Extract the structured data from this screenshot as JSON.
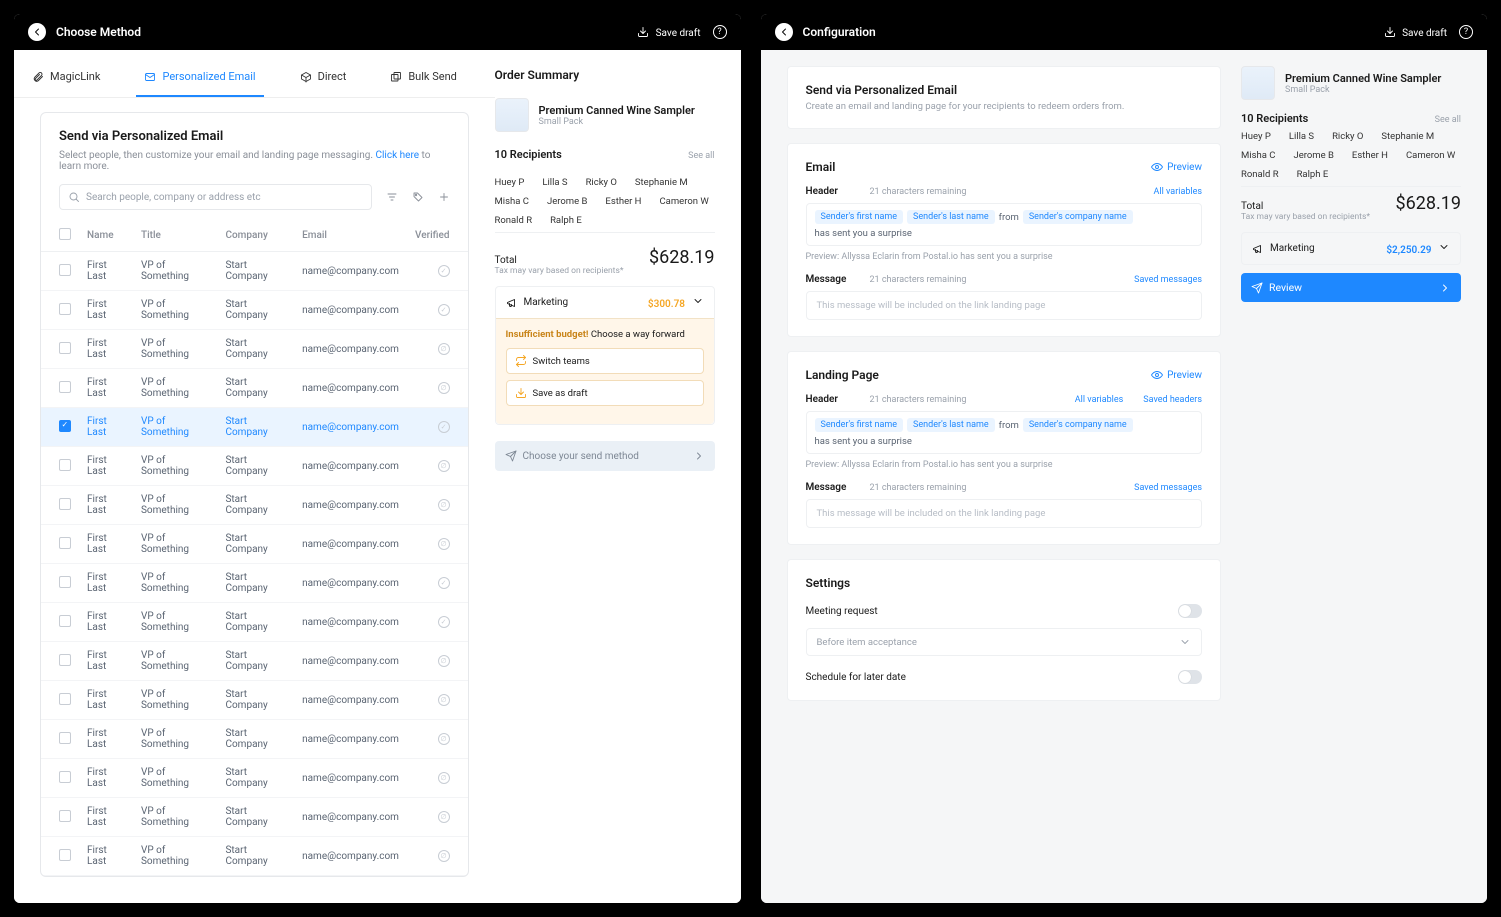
{
  "left": {
    "topbar": {
      "title": "Choose Method",
      "save_draft": "Save draft"
    },
    "tabs": {
      "magiclink": "MagicLink",
      "email": "Personalized Email",
      "direct": "Direct",
      "bulk": "Bulk Send"
    },
    "card": {
      "title": "Send via Personalized Email",
      "subtext_pre": "Select people, then customize your email and landing page messaging. ",
      "subtext_link": "Click here",
      "subtext_post": " to learn more.",
      "search_placeholder": "Search people, company or address etc"
    },
    "table": {
      "headers": {
        "name": "Name",
        "title": "Title",
        "company": "Company",
        "email": "Email",
        "verified": "Verified"
      },
      "selected_index": 4,
      "rows": [
        {
          "name": "First Last",
          "title": "VP of Something",
          "company": "Start Company",
          "email": "name@company.com",
          "verified": true
        },
        {
          "name": "First Last",
          "title": "VP of Something",
          "company": "Start Company",
          "email": "name@company.com",
          "verified": true
        },
        {
          "name": "First Last",
          "title": "VP of Something",
          "company": "Start Company",
          "email": "name@company.com",
          "verified": false
        },
        {
          "name": "First Last",
          "title": "VP of Something",
          "company": "Start Company",
          "email": "name@company.com",
          "verified": false
        },
        {
          "name": "First Last",
          "title": "VP of Something",
          "company": "Start Company",
          "email": "name@company.com",
          "verified": true
        },
        {
          "name": "First Last",
          "title": "VP of Something",
          "company": "Start Company",
          "email": "name@company.com",
          "verified": false
        },
        {
          "name": "First Last",
          "title": "VP of Something",
          "company": "Start Company",
          "email": "name@company.com",
          "verified": false
        },
        {
          "name": "First Last",
          "title": "VP of Something",
          "company": "Start Company",
          "email": "name@company.com",
          "verified": false
        },
        {
          "name": "First Last",
          "title": "VP of Something",
          "company": "Start Company",
          "email": "name@company.com",
          "verified": true
        },
        {
          "name": "First Last",
          "title": "VP of Something",
          "company": "Start Company",
          "email": "name@company.com",
          "verified": true
        },
        {
          "name": "First Last",
          "title": "VP of Something",
          "company": "Start Company",
          "email": "name@company.com",
          "verified": false
        },
        {
          "name": "First Last",
          "title": "VP of Something",
          "company": "Start Company",
          "email": "name@company.com",
          "verified": false
        },
        {
          "name": "First Last",
          "title": "VP of Something",
          "company": "Start Company",
          "email": "name@company.com",
          "verified": false
        },
        {
          "name": "First Last",
          "title": "VP of Something",
          "company": "Start Company",
          "email": "name@company.com",
          "verified": false
        },
        {
          "name": "First Last",
          "title": "VP of Something",
          "company": "Start Company",
          "email": "name@company.com",
          "verified": false
        },
        {
          "name": "First Last",
          "title": "VP of Something",
          "company": "Start Company",
          "email": "name@company.com",
          "verified": false
        }
      ]
    },
    "summary": {
      "heading": "Order Summary",
      "product_name": "Premium Canned Wine Sampler",
      "product_sub": "Small Pack",
      "recipients_heading": "10 Recipients",
      "see_all": "See all",
      "recipients": [
        "Huey P",
        "Lilla S",
        "Ricky O",
        "Stephanie M",
        "Misha C",
        "Jerome B",
        "Esther H",
        "Cameron W",
        "Ronald R",
        "Ralph E"
      ],
      "total_label": "Total",
      "tax_note": "Tax may vary based on recipients*",
      "total_amount": "$628.19",
      "account_name": "Marketing",
      "account_balance": "$300.78",
      "insufficient_bold": "Insufficient budget!",
      "insufficient_rest": " Choose a way forward",
      "option_switch": "Switch teams",
      "option_save": "Save as draft",
      "send_method": "Choose your send method"
    }
  },
  "right": {
    "topbar": {
      "title": "Configuration",
      "save_draft": "Save draft"
    },
    "intro": {
      "title": "Send via Personalized Email",
      "desc": "Create an email and landing page for your recipients to redeem orders from."
    },
    "email": {
      "heading": "Email",
      "preview": "Preview",
      "header_lbl": "Header",
      "chars": "21 characters remaining",
      "all_vars": "All variables",
      "tokens": [
        "Sender's first name",
        "Sender's last name"
      ],
      "from": "from",
      "token3": "Sender's company name",
      "tail": "has sent you a surprise",
      "prev_lbl": "Preview:",
      "prev_text": " Allyssa Eclarin from Postal.io has sent you a surprise",
      "message_lbl": "Message",
      "saved_msgs": "Saved messages",
      "message_placeholder": "This message will be included on the link landing page"
    },
    "landing": {
      "heading": "Landing Page",
      "preview": "Preview",
      "header_lbl": "Header",
      "chars": "21 characters remaining",
      "all_vars": "All variables",
      "saved_headers": "Saved headers",
      "tokens": [
        "Sender's first name",
        "Sender's last name"
      ],
      "from": "from",
      "token3": "Sender's company name",
      "tail": "has sent you a surprise",
      "prev_lbl": "Preview:",
      "prev_text": " Allyssa Eclarin from Postal.io has sent you a surprise",
      "message_lbl": "Message",
      "chars2": "21 characters remaining",
      "saved_msgs": "Saved messages",
      "message_placeholder": "This message will be included on the link landing page"
    },
    "settings": {
      "heading": "Settings",
      "meeting": "Meeting request",
      "before": "Before item acceptance",
      "schedule": "Schedule for later date"
    },
    "summary": {
      "product_name": "Premium Canned Wine Sampler",
      "product_sub": "Small Pack",
      "recipients_heading": "10 Recipients",
      "see_all": "See all",
      "recipients": [
        "Huey P",
        "Lilla S",
        "Ricky O",
        "Stephanie M",
        "Misha C",
        "Jerome B",
        "Esther H",
        "Cameron W",
        "Ronald R",
        "Ralph E"
      ],
      "total_label": "Total",
      "tax_note": "Tax may vary based on recipients*",
      "total_amount": "$628.19",
      "account_name": "Marketing",
      "account_balance": "$2,250.29",
      "review": "Review"
    }
  }
}
